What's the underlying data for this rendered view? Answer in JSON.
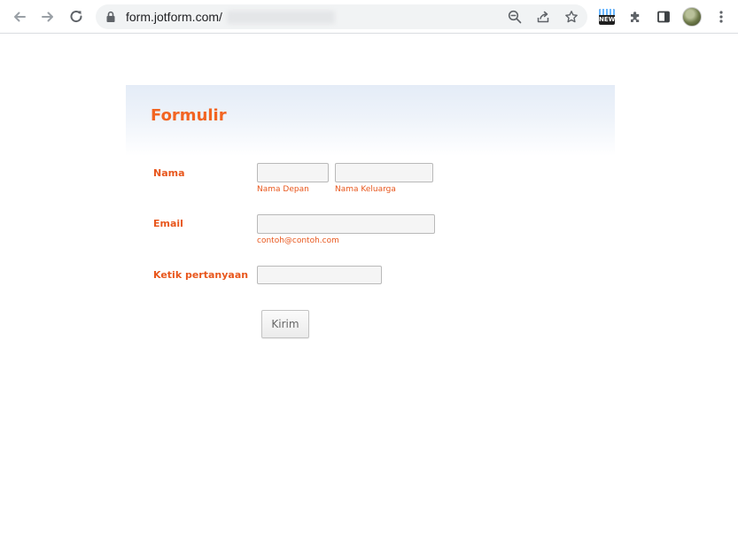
{
  "browser": {
    "url_host": "form.jotform.com/",
    "extension_badge": "NEW",
    "icons": [
      "back-icon",
      "forward-icon",
      "reload-icon",
      "lock-icon",
      "zoom-out-icon",
      "share-icon",
      "bookmark-star-icon",
      "extension-new-icon",
      "puzzle-icon",
      "side-panel-icon",
      "profile-avatar",
      "more-menu-icon"
    ]
  },
  "form": {
    "title": "Formulir",
    "fields": {
      "name": {
        "label": "Nama",
        "first_value": "",
        "last_value": "",
        "first_sublabel": "Nama Depan",
        "last_sublabel": "Nama Keluarga"
      },
      "email": {
        "label": "Email",
        "value": "",
        "sublabel": "contoh@contoh.com"
      },
      "question": {
        "label": "Ketik pertanyaan",
        "value": ""
      }
    },
    "submit_label": "Kirim"
  },
  "colors": {
    "accent": "#f26522",
    "label": "#e8571d",
    "header_gradient_top": "#e4ecf7"
  }
}
